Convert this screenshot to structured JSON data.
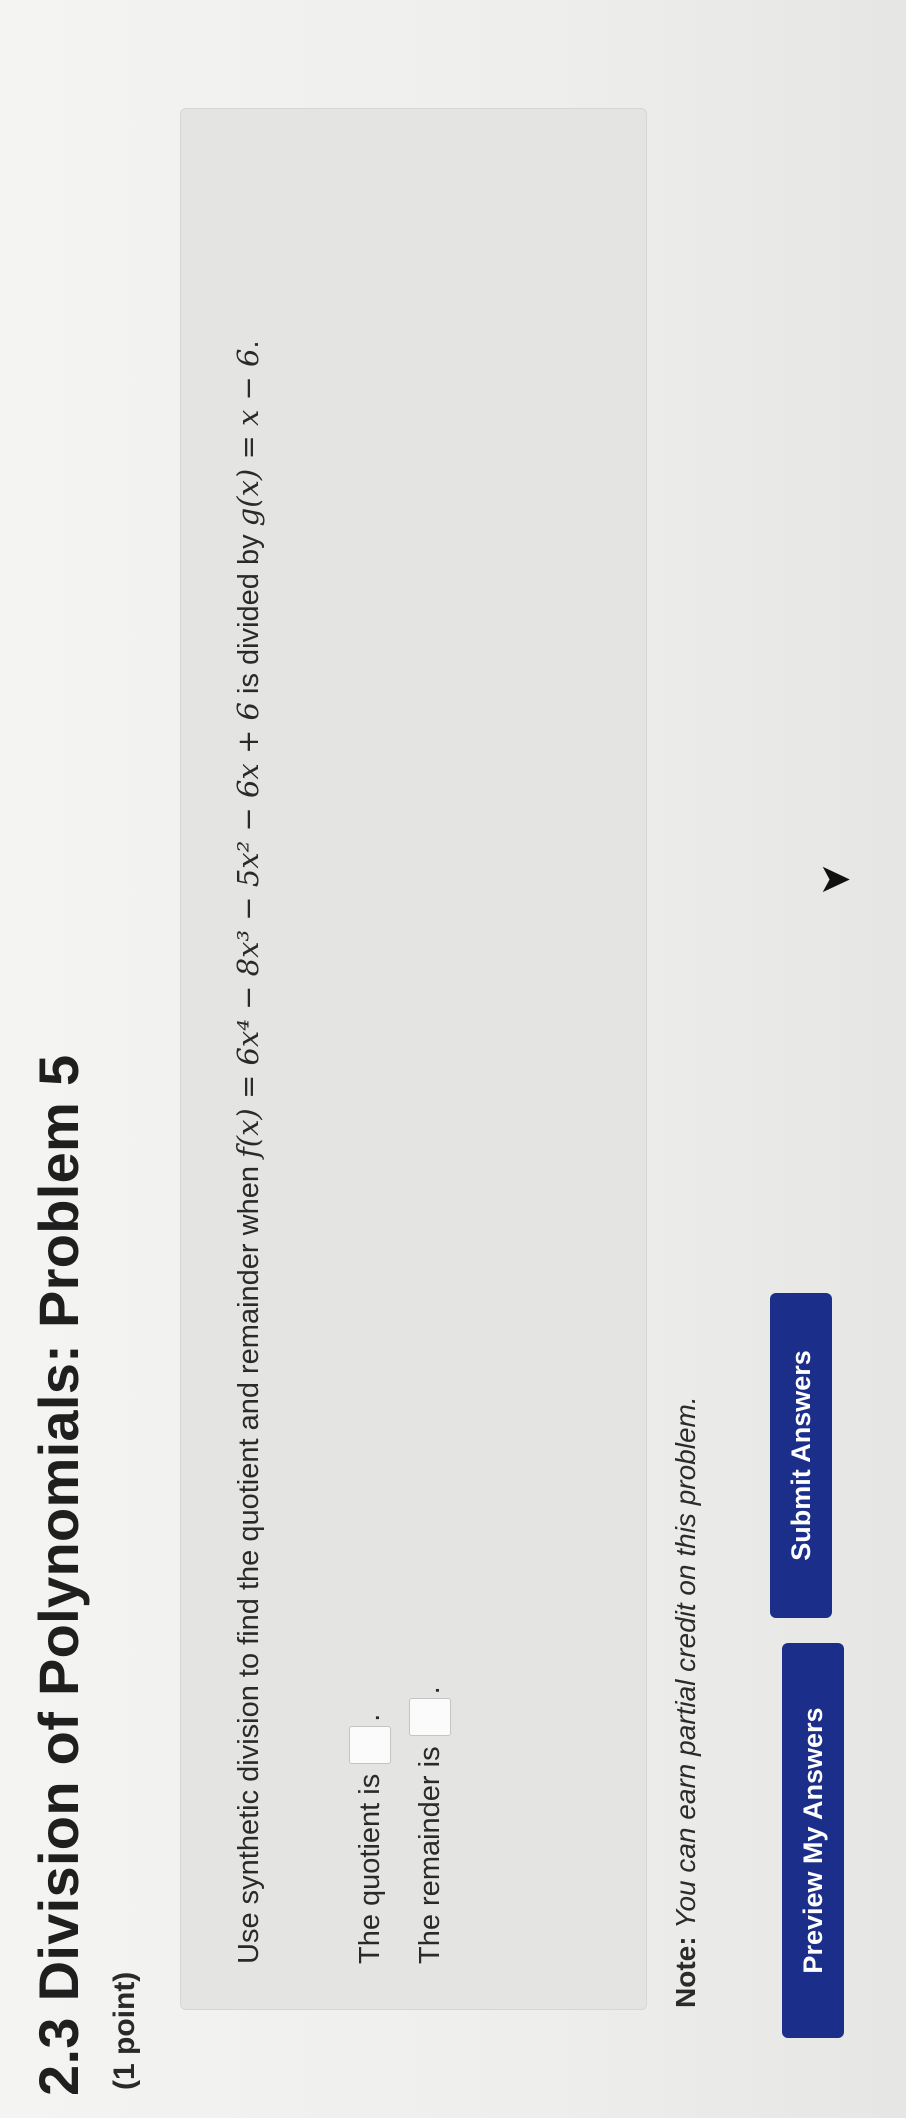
{
  "header": {
    "title": "2.3 Division of Polynomials: Problem 5",
    "points": "(1 point)"
  },
  "problem": {
    "intro": "Use synthetic division to find the quotient and remainder when ",
    "f_expr": "f(x) = 6x⁴ − 8x³ − 5x² − 6x + 6",
    "divided_by": " is divided by ",
    "g_expr": "g(x) = x − 6",
    "end_punct": "."
  },
  "answers": {
    "quotient_label": "The quotient is",
    "quotient_value": "",
    "remainder_label": "The remainder is",
    "remainder_value": "",
    "end_punct": "."
  },
  "note": {
    "label": "Note:",
    "text": "You can earn partial credit on this problem."
  },
  "buttons": {
    "preview_label": "Preview My Answers",
    "submit_label": "Submit Answers"
  },
  "colors": {
    "button_bg": "#1b2e8a",
    "button_text": "#ffffff"
  }
}
